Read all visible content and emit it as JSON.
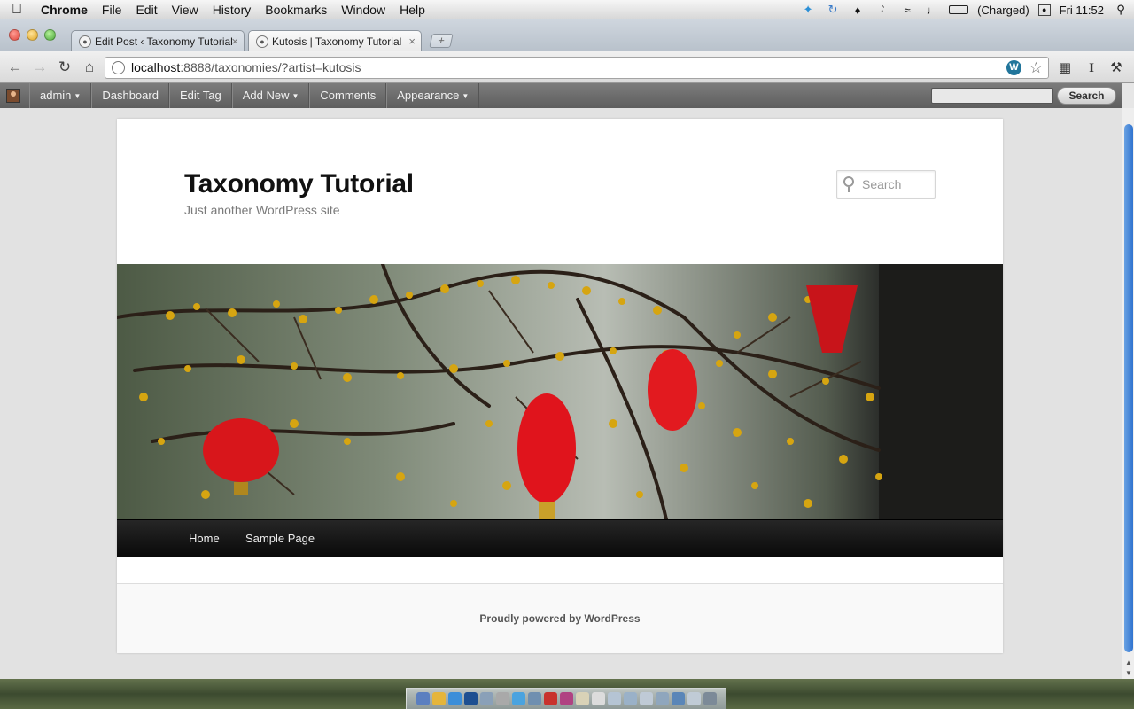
{
  "menubar": {
    "app_name": "Chrome",
    "menus": [
      "File",
      "Edit",
      "View",
      "History",
      "Bookmarks",
      "Window",
      "Help"
    ],
    "battery_status": "(Charged)",
    "clock": "Fri 11:52"
  },
  "browser": {
    "tabs": [
      {
        "title": "Edit Post ‹ Taxonomy Tutorial",
        "active": false
      },
      {
        "title": "Kutosis | Taxonomy Tutorial",
        "active": true
      }
    ],
    "url_host": "localhost",
    "url_rest": ":8888/taxonomies/?artist=kutosis"
  },
  "adminbar": {
    "items": [
      {
        "label": "admin",
        "dropdown": true
      },
      {
        "label": "Dashboard",
        "dropdown": false
      },
      {
        "label": "Edit Tag",
        "dropdown": false
      },
      {
        "label": "Add New",
        "dropdown": true
      },
      {
        "label": "Comments",
        "dropdown": false
      },
      {
        "label": "Appearance",
        "dropdown": true
      }
    ],
    "search_button": "Search"
  },
  "site": {
    "title": "Taxonomy Tutorial",
    "description": "Just another WordPress site",
    "search_placeholder": "Search",
    "nav": [
      "Home",
      "Sample Page"
    ],
    "footer_credit": "Proudly powered by WordPress"
  },
  "colors": {
    "admin_bar": "#666666",
    "nav_bar": "#1a1a1a",
    "scroll_thumb": "#2f73cf",
    "lantern_red": "#d8161b",
    "blossom_yellow": "#d6a511"
  }
}
